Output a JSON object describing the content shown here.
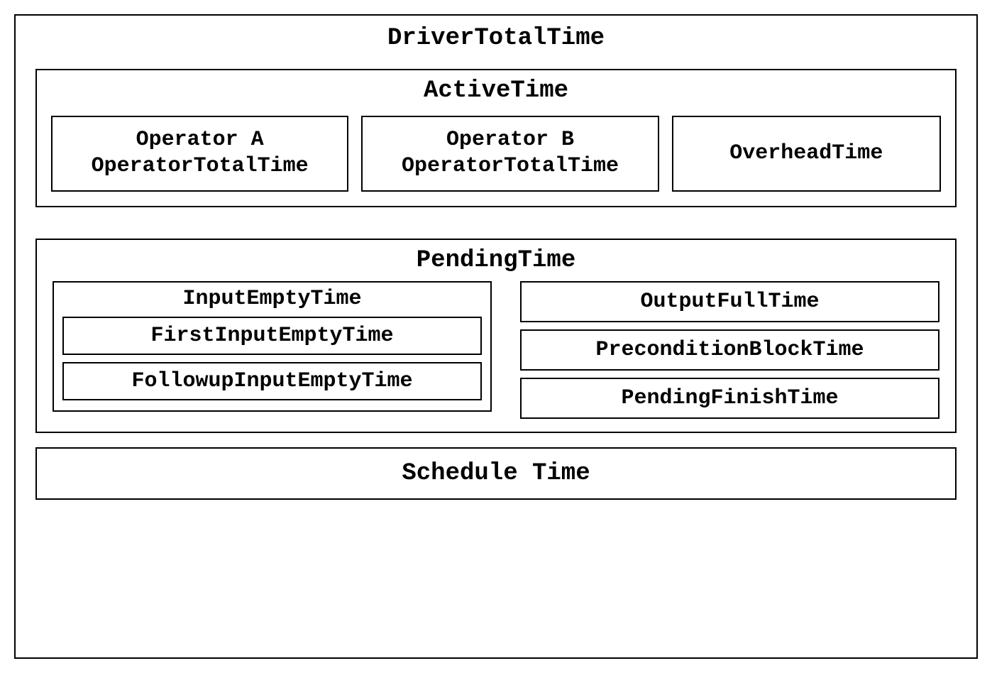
{
  "driver": {
    "title": "DriverTotalTime",
    "active": {
      "title": "ActiveTime",
      "operatorA": {
        "line1": "Operator A",
        "line2": "OperatorTotalTime"
      },
      "operatorB": {
        "line1": "Operator B",
        "line2": "OperatorTotalTime"
      },
      "overhead": "OverheadTime"
    },
    "pending": {
      "title": "PendingTime",
      "inputEmpty": {
        "title": "InputEmptyTime",
        "first": "FirstInputEmptyTime",
        "followup": "FollowupInputEmptyTime"
      },
      "outputFull": "OutputFullTime",
      "preconditionBlock": "PreconditionBlockTime",
      "pendingFinish": "PendingFinishTime"
    },
    "schedule": "Schedule Time"
  }
}
